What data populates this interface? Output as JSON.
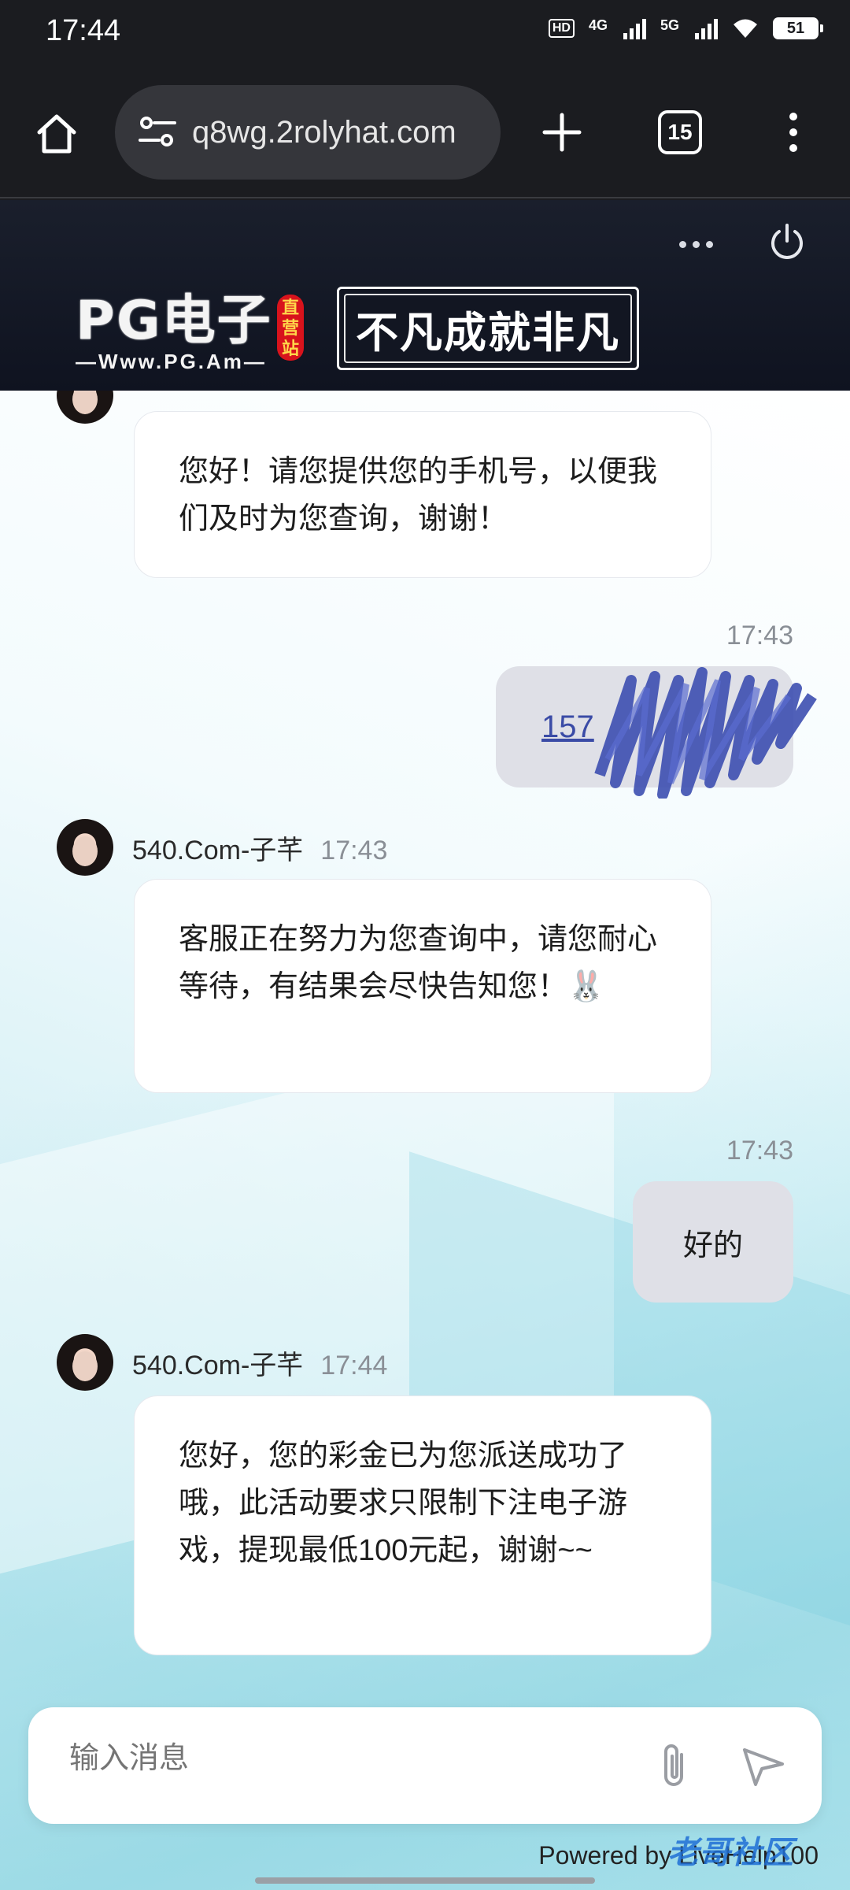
{
  "status_bar": {
    "time": "17:44",
    "hd_label": "HD",
    "net1_label": "4G",
    "net2_label": "5G",
    "battery": "51"
  },
  "browser": {
    "url": "q8wg.2rolyhat.com",
    "tab_count": "15"
  },
  "site_header": {
    "logo_text": "PG电子",
    "logo_badge": "直营站",
    "logo_url": "—Www.PG.Am—",
    "slogan": "不凡成就非凡"
  },
  "messages": [
    {
      "type": "in",
      "text": "您好！请您提供您的手机号，以便我们及时为您查询，谢谢！"
    },
    {
      "type": "out",
      "time": "17:43",
      "text": "157"
    },
    {
      "type": "in",
      "sender": "540.Com-子芊",
      "time": "17:43",
      "text": "客服正在努力为您查询中，请您耐心等待，有结果会尽快告知您！🐰"
    },
    {
      "type": "out",
      "time": "17:43",
      "text": "好的"
    },
    {
      "type": "in",
      "sender": "540.Com-子芊",
      "time": "17:44",
      "text": "您好，您的彩金已为您派送成功了哦，此活动要求只限制下注电子游戏，提现最低100元起，谢谢~~"
    }
  ],
  "input": {
    "placeholder": "输入消息"
  },
  "footer": {
    "powered_by": "Powered by LiveHelp100",
    "watermark": "老哥社区"
  },
  "colors": {
    "bubble_out": "#dfe0e7",
    "bubble_in": "#ffffff",
    "link": "#3a4ba6"
  }
}
